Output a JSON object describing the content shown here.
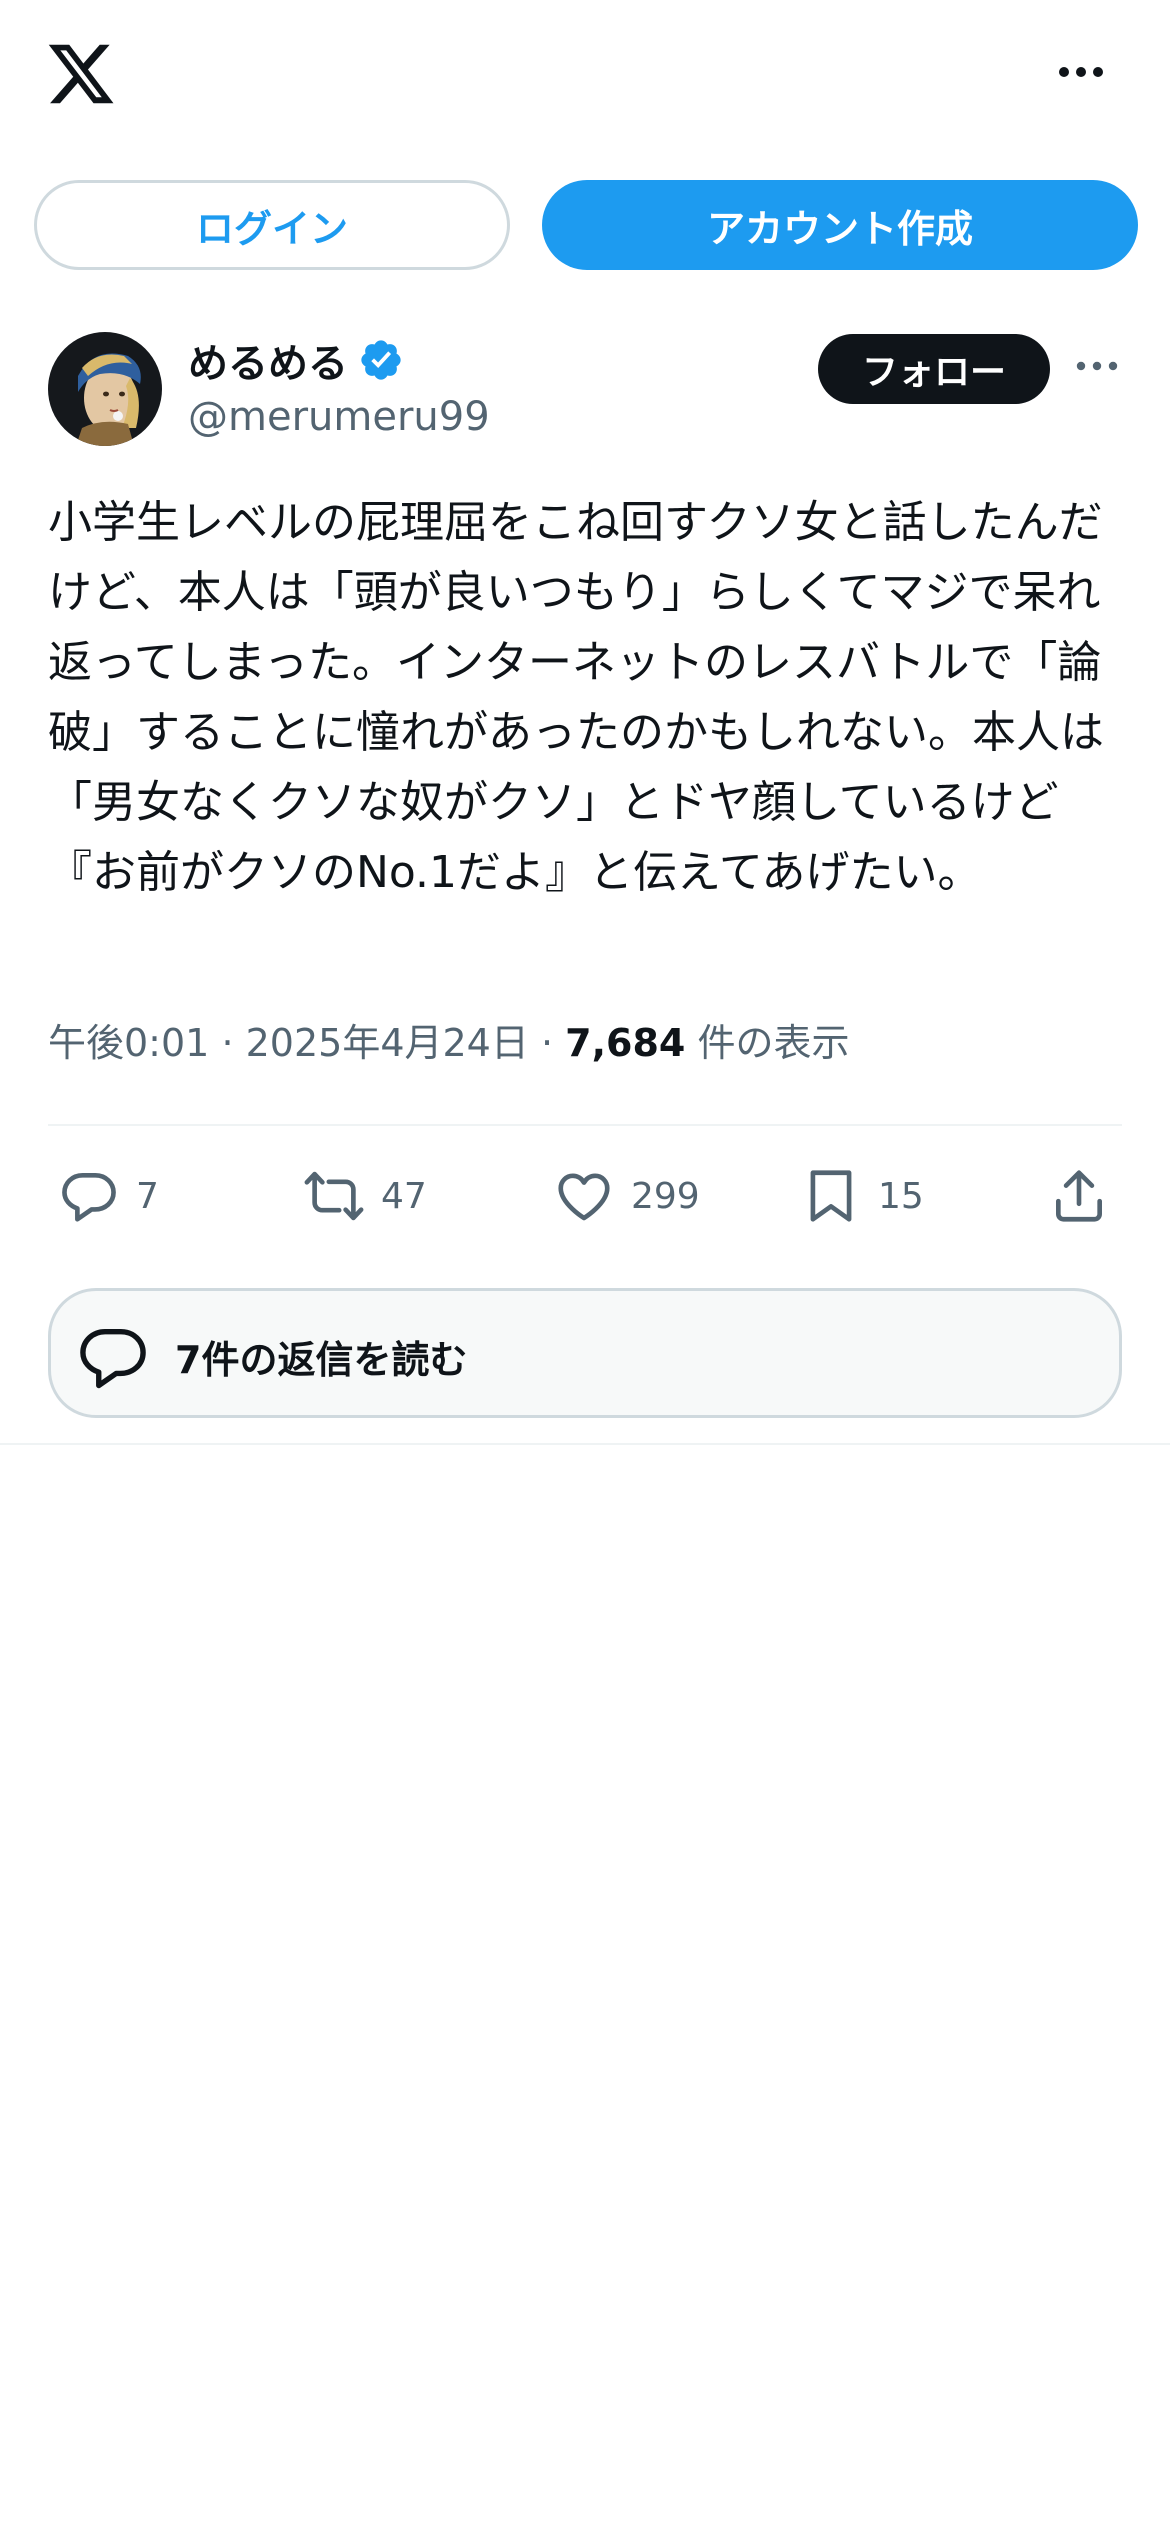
{
  "header": {
    "logo_icon": "x-logo-icon",
    "more_icon": "more-horizontal-icon"
  },
  "auth": {
    "login_label": "ログイン",
    "signup_label": "アカウント作成"
  },
  "author": {
    "display_name": "めるめる",
    "handle": "@merumeru99",
    "verified_icon": "verified-badge-icon",
    "follow_label": "フォロー"
  },
  "tweet": {
    "text": "小学生レベルの屁理屈をこね回すクソ女と話したんだけど、本人は「頭が良いつもり」らしくてマジで呆れ返ってしまった。インターネットのレスバトルで「論破」することに憧れがあったのかもしれない。本人は「男女なくクソな奴がクソ」とドヤ顔しているけど『お前がクソのNo.1だよ』と伝えてあげたい。",
    "time": "午後0:01",
    "separator": "·",
    "date": "2025年4月24日",
    "views_count": "7,684",
    "views_label": "件の表示"
  },
  "actions": {
    "replies": "7",
    "reposts": "47",
    "likes": "299",
    "bookmarks": "15"
  },
  "read_replies": {
    "label": "7件の返信を読む"
  },
  "colors": {
    "accent": "#1d9bf0",
    "text": "#0f1419",
    "secondary": "#536471",
    "border": "#cfd9de"
  }
}
